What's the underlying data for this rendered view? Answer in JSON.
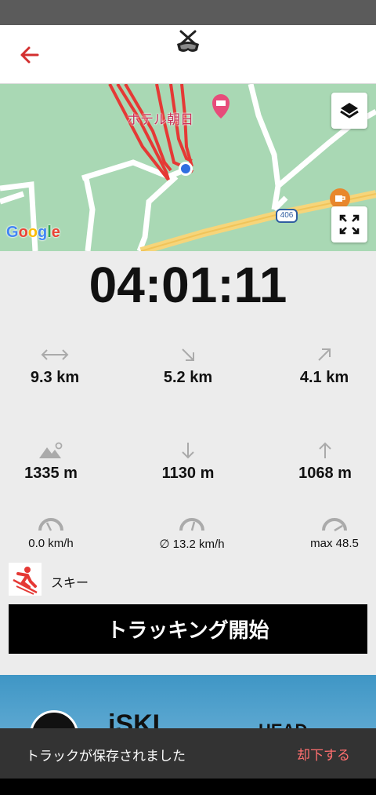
{
  "header": {
    "back_icon": "arrow-left-icon",
    "logo_icon": "ski-goggles-logo-icon",
    "accent_color": "#d32f2f"
  },
  "map": {
    "place_label": "ホテル朝日",
    "route_number": "406",
    "attribution": "Google",
    "layers_icon": "layers-icon",
    "fullscreen_icon": "expand-icon",
    "track_color": "#e53935"
  },
  "timer": "04:01:11",
  "stats": {
    "distance_total": "9.3 km",
    "distance_down": "5.2 km",
    "distance_up": "4.1 km",
    "max_altitude": "1335 m",
    "descent": "1130 m",
    "ascent": "1068 m",
    "current_speed": "0.0 km/h",
    "avg_speed": "∅ 13.2 km/h",
    "max_speed": "max 48.5"
  },
  "sport": {
    "label": "スキー",
    "icon": "skier-icon"
  },
  "start_button_label": "トラッキング開始",
  "banner": {
    "brand": "iSKI",
    "brand2": "HEAD"
  },
  "snackbar": {
    "message": "トラックが保存されました",
    "action": "却下する"
  }
}
